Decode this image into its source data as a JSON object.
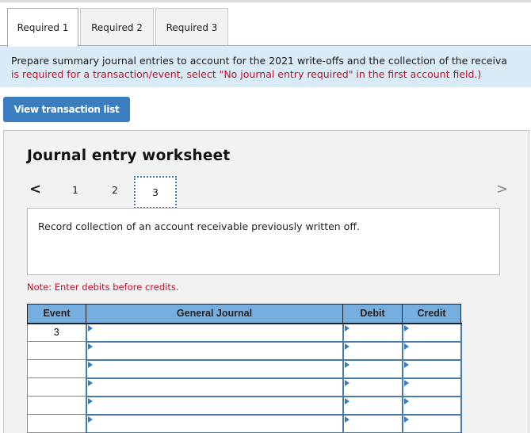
{
  "tabs": [
    {
      "label": "Required 1",
      "active": true
    },
    {
      "label": "Required 2",
      "active": false
    },
    {
      "label": "Required 3",
      "active": false
    }
  ],
  "instructions": {
    "line1": "Prepare summary journal entries to account for the 2021 write-offs and the collection of the receiva",
    "line2": "is required for a transaction/event, select \"No journal entry required\" in the first account field.)"
  },
  "view_transaction_button": "View transaction list",
  "worksheet": {
    "title": "Journal entry worksheet",
    "nav": {
      "prev": "<",
      "next": ">",
      "pages": [
        "1",
        "2",
        "3"
      ],
      "current_page": "3"
    },
    "description": "Record collection of an account receivable previously written off.",
    "note": "Note: Enter debits before credits.",
    "table": {
      "headers": {
        "event": "Event",
        "general_journal": "General Journal",
        "debit": "Debit",
        "credit": "Credit"
      },
      "rows": [
        {
          "event": "3",
          "account": "",
          "debit": "",
          "credit": ""
        },
        {
          "event": "",
          "account": "",
          "debit": "",
          "credit": ""
        },
        {
          "event": "",
          "account": "",
          "debit": "",
          "credit": ""
        },
        {
          "event": "",
          "account": "",
          "debit": "",
          "credit": ""
        },
        {
          "event": "",
          "account": "",
          "debit": "",
          "credit": ""
        },
        {
          "event": "",
          "account": "",
          "debit": "",
          "credit": ""
        }
      ]
    }
  }
}
